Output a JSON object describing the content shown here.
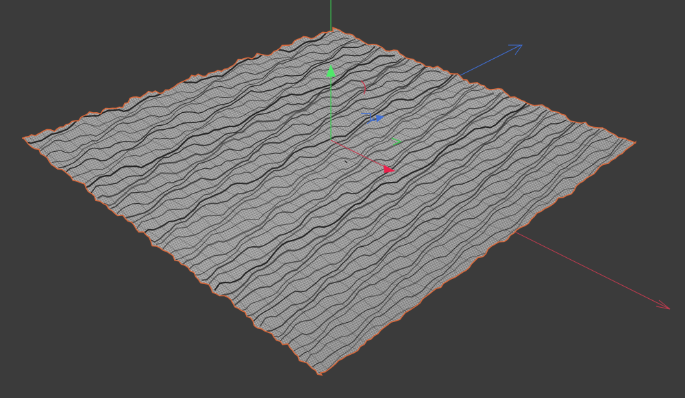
{
  "viewport": {
    "background": "#3b3b3b",
    "mesh": {
      "surface_color": "#8f8f8f",
      "wire_color": "#e6e6e6",
      "crease_color": "#141414",
      "selection_outline": "#d9683a"
    },
    "axes": {
      "x_color": "#c23a4e",
      "y_color": "#39d04f",
      "z_color": "#3f6fd8"
    },
    "gizmo": {
      "icons": [
        "move-y-arrow-icon",
        "move-x-arrow-icon",
        "move-z-arrow-icon",
        "rotate-x-ring-icon",
        "scale-z-handle-icon",
        "scale-x-handle-icon"
      ]
    }
  }
}
